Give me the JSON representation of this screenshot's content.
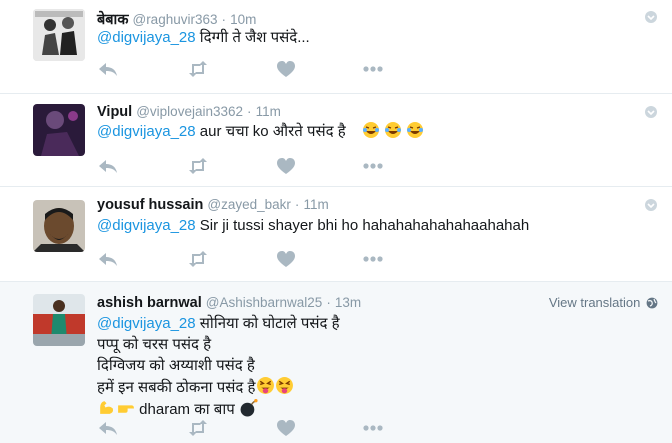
{
  "tweets": [
    {
      "fullname": "बेबाक",
      "username": "@raghuvir363",
      "time": "10m",
      "mention": "@digvijaya_28",
      "text": " दिग्गी ते जैश पसंदे..."
    },
    {
      "fullname": "Vipul",
      "username": "@viplovejain3362",
      "time": "11m",
      "mention": "@digvijaya_28",
      "text": " aur चचा ko औरते पसंद है",
      "emoji": [
        "face-with-tears-of-joy",
        "face-with-tears-of-joy",
        "face-with-tears-of-joy"
      ]
    },
    {
      "fullname": "yousuf hussain",
      "username": "@zayed_bakr",
      "time": "11m",
      "mention": "@digvijaya_28",
      "text": " Sir ji tussi shayer bhi ho hahahahahahahaahahah"
    },
    {
      "fullname": "ashish barnwal",
      "username": "@Ashishbarnwal25",
      "time": "13m",
      "translate_label": "View translation",
      "mention": "@digvijaya_28",
      "lines": [
        " सोनिया को घोटाले पसंद है",
        "पप्पू को चरस पसंद है",
        "दिग्विजय को अय्याशी पसंद है",
        "हमें इन सबकी ठोकना पसंद है",
        "dharam का बाप"
      ],
      "emoji_line4": [
        "squinting-face-with-tongue",
        "squinting-face-with-tongue"
      ],
      "emoji_line5_prefix": [
        "flexed-biceps",
        "backhand-index-pointing-right"
      ],
      "emoji_line5_suffix": [
        "bomb"
      ]
    }
  ],
  "separator": "·",
  "icons": {
    "reply": "reply-icon",
    "retweet": "retweet-icon",
    "like": "heart-icon",
    "more": "more-icon",
    "chevron": "chevron-down-icon",
    "globe": "globe-icon"
  },
  "colors": {
    "link": "#1b95e0",
    "muted": "#8899a6",
    "icon": "#aab8c2",
    "highlight_bg": "#f5f8fa"
  }
}
